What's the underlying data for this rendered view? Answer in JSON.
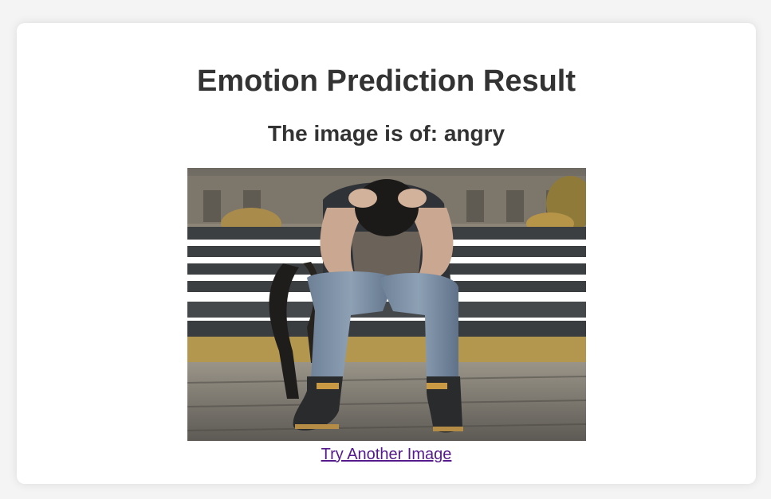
{
  "page": {
    "title": "Emotion Prediction Result",
    "result_text": "The image is of: angry",
    "link_label": "Try Another Image"
  },
  "image": {
    "subject": "person sitting on a park bench with head in hands"
  },
  "colors": {
    "page_bg": "#f4f4f4",
    "card_bg": "#ffffff",
    "text": "#333333",
    "visited_link": "#551a8b"
  }
}
